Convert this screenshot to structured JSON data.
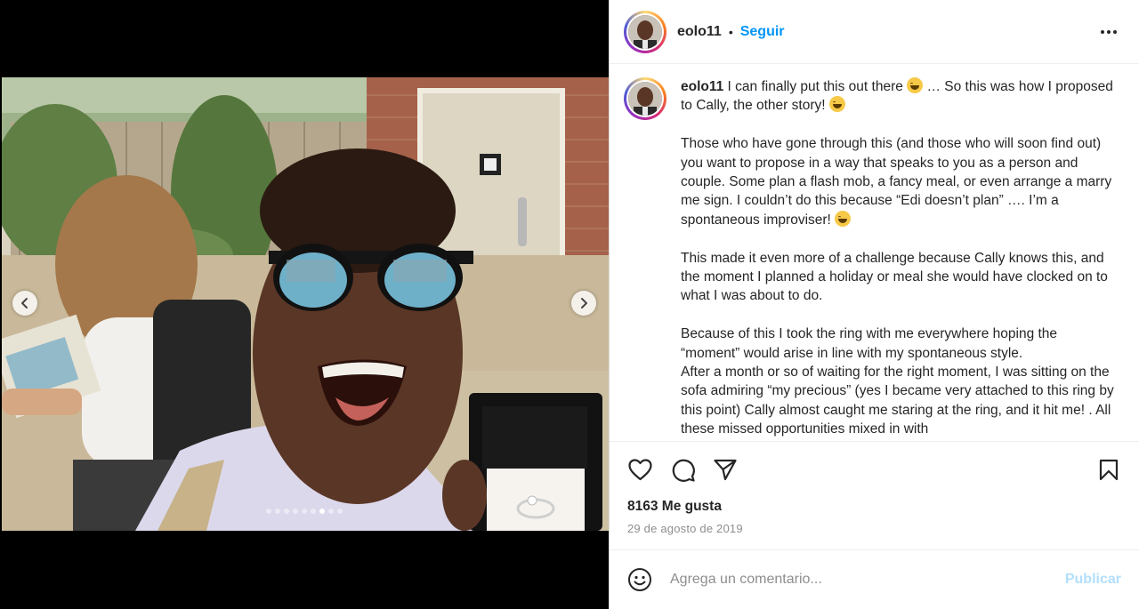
{
  "post": {
    "username": "eolo11",
    "separator": "•",
    "follow_label": "Seguir",
    "more_label": "More options"
  },
  "caption": {
    "username": "eolo11",
    "intro_1": " I can finally put this out there ",
    "intro_2": " … So this was how I proposed to Cally, the other story! ",
    "para_1": "Those who have gone through this (and those who will soon find out) you want to propose in a way that speaks to you as a person and couple. Some plan a flash mob, a fancy meal, or even arrange a marry me sign. I couldn’t do this because “Edi doesn’t plan” …. I’m a spontaneous improviser! ",
    "para_2": "This made it even more of a challenge because Cally knows this, and the moment I planned a holiday or meal she would have clocked on to what I was about to do.",
    "para_3": "Because of this I took the ring with me everywhere hoping the “moment” would arise in line with my spontaneous style.",
    "para_4": "After a month or so of waiting for the right moment, I was sitting on the sofa admiring “my precious” (yes I became very attached to this ring by this point) Cally almost caught me staring at the ring, and it hit me! . All these missed opportunities mixed in with"
  },
  "stats": {
    "likes": "8163 Me gusta",
    "date": "29 de agosto de 2019"
  },
  "comment": {
    "placeholder": "Agrega un comentario...",
    "post_label": "Publicar"
  },
  "carousel": {
    "total": 9,
    "active_index": 6
  },
  "icons": {
    "like": "heart-icon",
    "comment": "comment-icon",
    "share": "share-icon",
    "save": "bookmark-icon",
    "emoji": "emoji-icon",
    "more": "more-horizontal-icon"
  },
  "colors": {
    "accent": "#0095f6",
    "post_disabled": "#b2dffc",
    "text": "#262626",
    "muted": "#8e8e8e"
  }
}
